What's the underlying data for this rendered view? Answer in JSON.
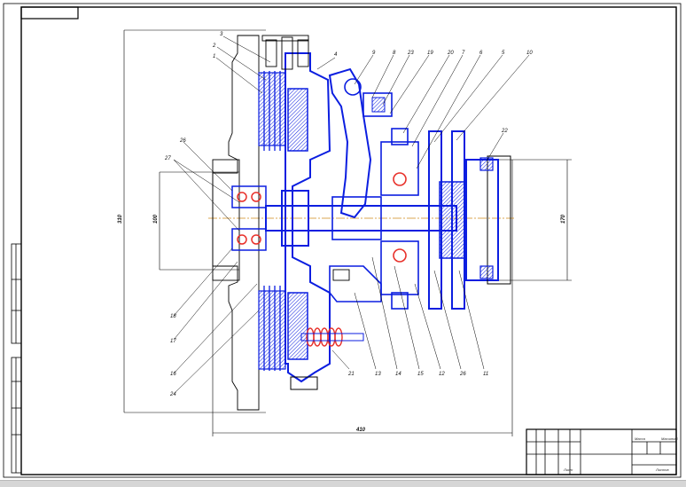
{
  "drawing": {
    "dimensions": {
      "overall_height": "310",
      "overall_length": "410",
      "shaft_dia_left": "100",
      "shaft_dia_right": "170"
    },
    "callouts_top": [
      "3",
      "2",
      "1",
      "4",
      "9",
      "8",
      "23",
      "19",
      "20",
      "7",
      "6",
      "5",
      "10",
      "22"
    ],
    "callouts_left": [
      "26",
      "27",
      "18",
      "17",
      "16",
      "24"
    ],
    "callouts_bottom": [
      "21",
      "13",
      "14",
      "15",
      "12",
      "26",
      "11"
    ],
    "title_block": {
      "cell_labels": [
        "Лист",
        "Масса",
        "Масштаб",
        "Листов"
      ]
    }
  },
  "colors": {
    "line": "#000000",
    "part": "#0b1ee0",
    "hatch": "#e8302a",
    "axis": "#d08a1a"
  }
}
